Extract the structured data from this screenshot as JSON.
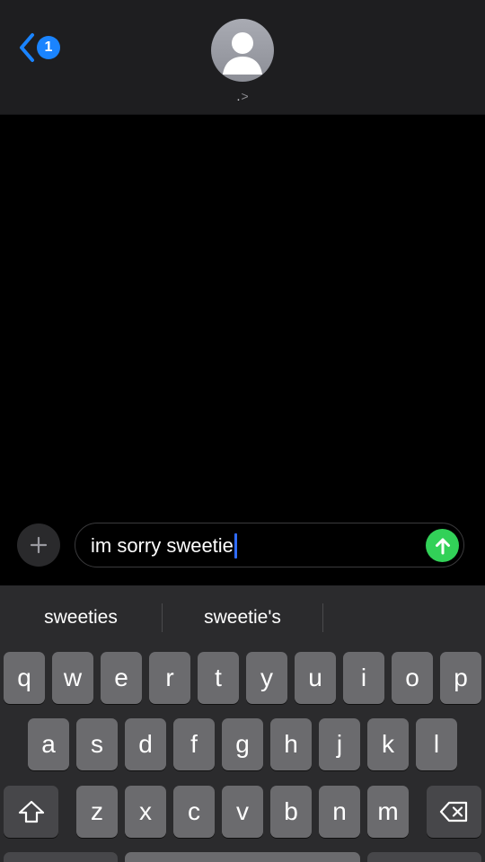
{
  "header": {
    "badge_count": "1",
    "contact_name": ".",
    "contact_chevron": ">"
  },
  "composer": {
    "text": "im sorry sweetie"
  },
  "suggestions": [
    "sweeties",
    "sweetie's"
  ],
  "keyboard": {
    "row1": [
      "q",
      "w",
      "e",
      "r",
      "t",
      "y",
      "u",
      "i",
      "o",
      "p"
    ],
    "row2": [
      "a",
      "s",
      "d",
      "f",
      "g",
      "h",
      "j",
      "k",
      "l"
    ],
    "row3": [
      "z",
      "x",
      "c",
      "v",
      "b",
      "n",
      "m"
    ]
  },
  "colors": {
    "accent_blue": "#1a84ff",
    "send_green": "#32d158",
    "key_bg": "#6b6b6e",
    "keyboard_bg": "#2b2b2d"
  }
}
